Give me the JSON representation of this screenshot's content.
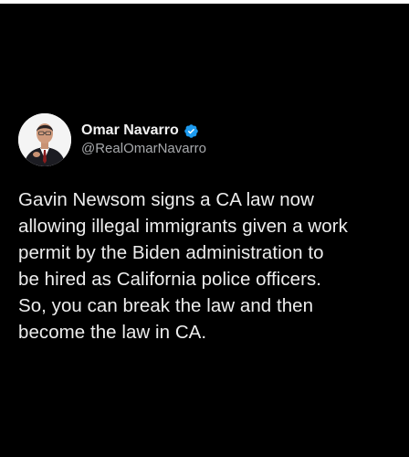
{
  "tweet": {
    "author": {
      "display_name": "Omar Navarro",
      "handle": "@RealOmarNavarro",
      "verified": true,
      "verified_icon": "verified-badge-icon",
      "verified_color": "#1d9bf0"
    },
    "text": "Gavin Newsom signs a CA law now\nallowing illegal immigrants given a work\npermit by the Biden administration to\nbe hired as California police officers.\nSo, you can break the law and then\nbecome the law in CA."
  },
  "colors": {
    "background": "#000000",
    "text": "#ededed",
    "handle": "#a7a9ac"
  }
}
